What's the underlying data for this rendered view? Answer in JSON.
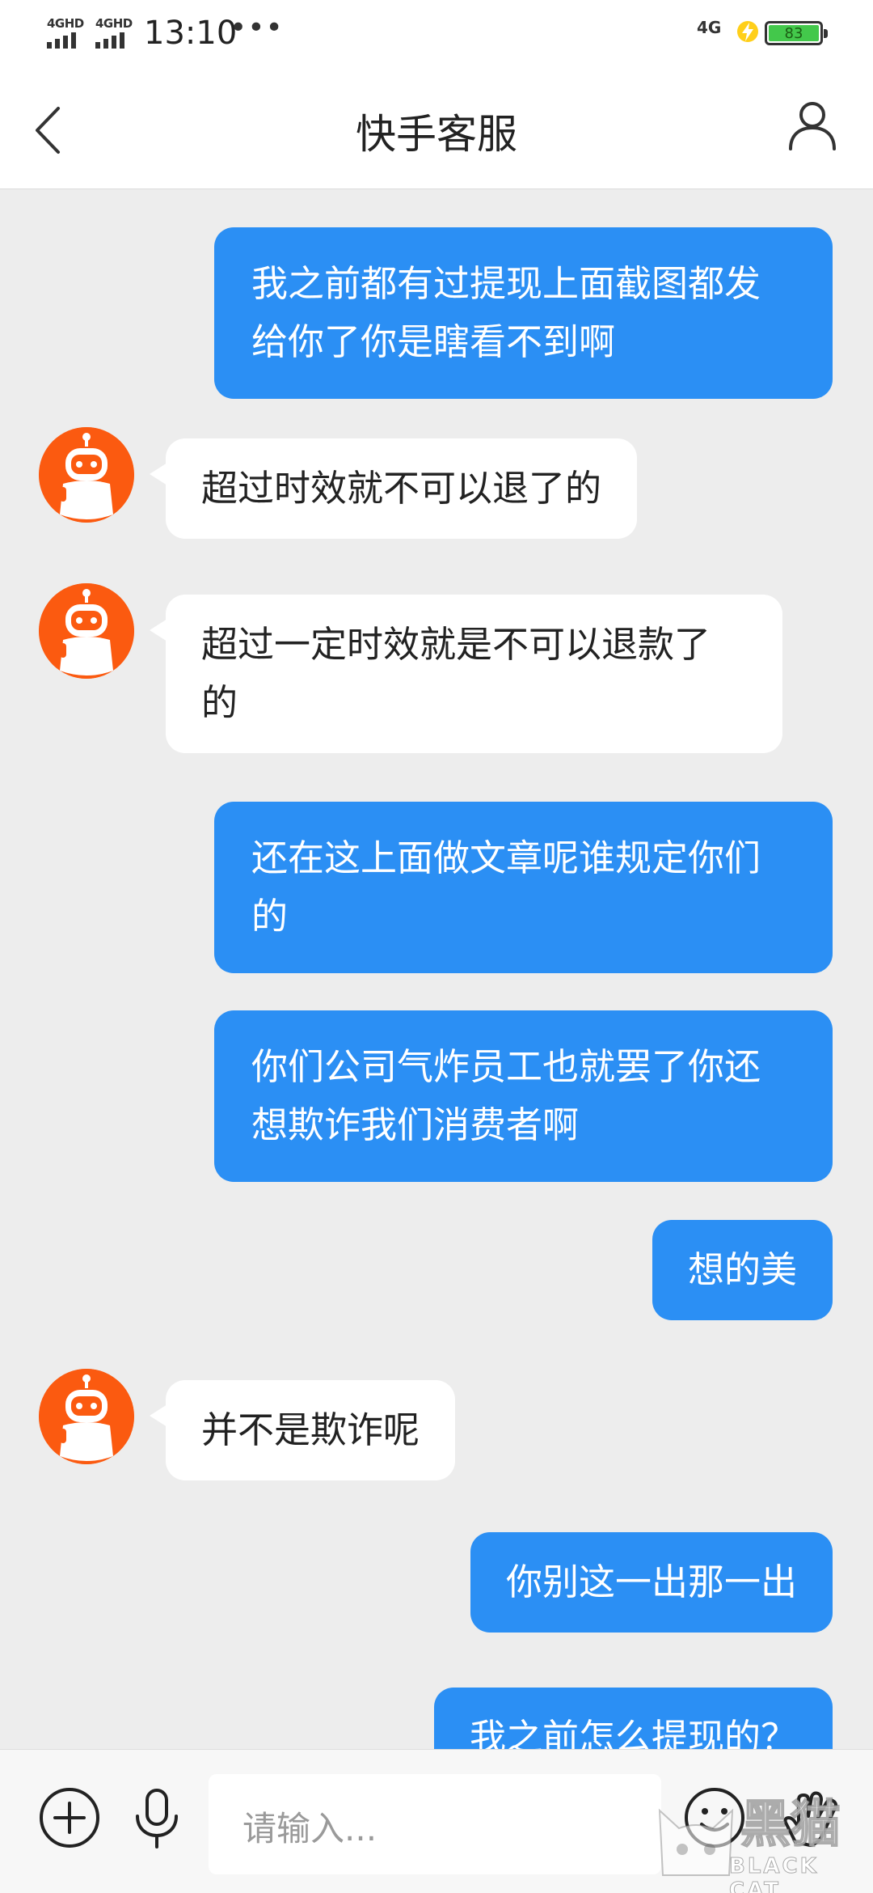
{
  "status_bar": {
    "signal_1": "4GHD",
    "signal_2": "4GHD",
    "time": "13:10",
    "more": "•••",
    "network": "4G",
    "battery": "83"
  },
  "header": {
    "title": "快手客服"
  },
  "messages": [
    {
      "side": "out",
      "text": "我之前都有过提现上面截图都发\n给你了你是瞎看不到啊"
    },
    {
      "side": "in",
      "text": "超过时效就不可以退了的"
    },
    {
      "side": "in",
      "text": "超过一定时效就是不可以退款了\n的"
    },
    {
      "side": "out",
      "text": "还在这上面做文章呢谁规定你们\n的"
    },
    {
      "side": "out",
      "text": "你们公司气炸员工也就罢了你还\n想欺诈我们消费者啊"
    },
    {
      "side": "out",
      "text": "想的美"
    },
    {
      "side": "in",
      "text": "并不是欺诈呢"
    },
    {
      "side": "out",
      "text": "你别这一出那一出"
    },
    {
      "side": "out",
      "text": "我之前怎么提现的？"
    }
  ],
  "input": {
    "placeholder": "请输入..."
  },
  "icons": {
    "back": "chevron-left-icon",
    "profile": "person-icon",
    "add": "plus-circle-icon",
    "voice": "microphone-icon",
    "emoji": "smiley-icon",
    "gesture": "hand-icon"
  },
  "watermark": {
    "cn": "黑猫",
    "en": "BLACK CAT"
  },
  "colors": {
    "outgoing_bubble": "#2b8ff4",
    "incoming_bubble": "#ffffff",
    "background": "#ededed",
    "avatar": "#fb5a10"
  }
}
